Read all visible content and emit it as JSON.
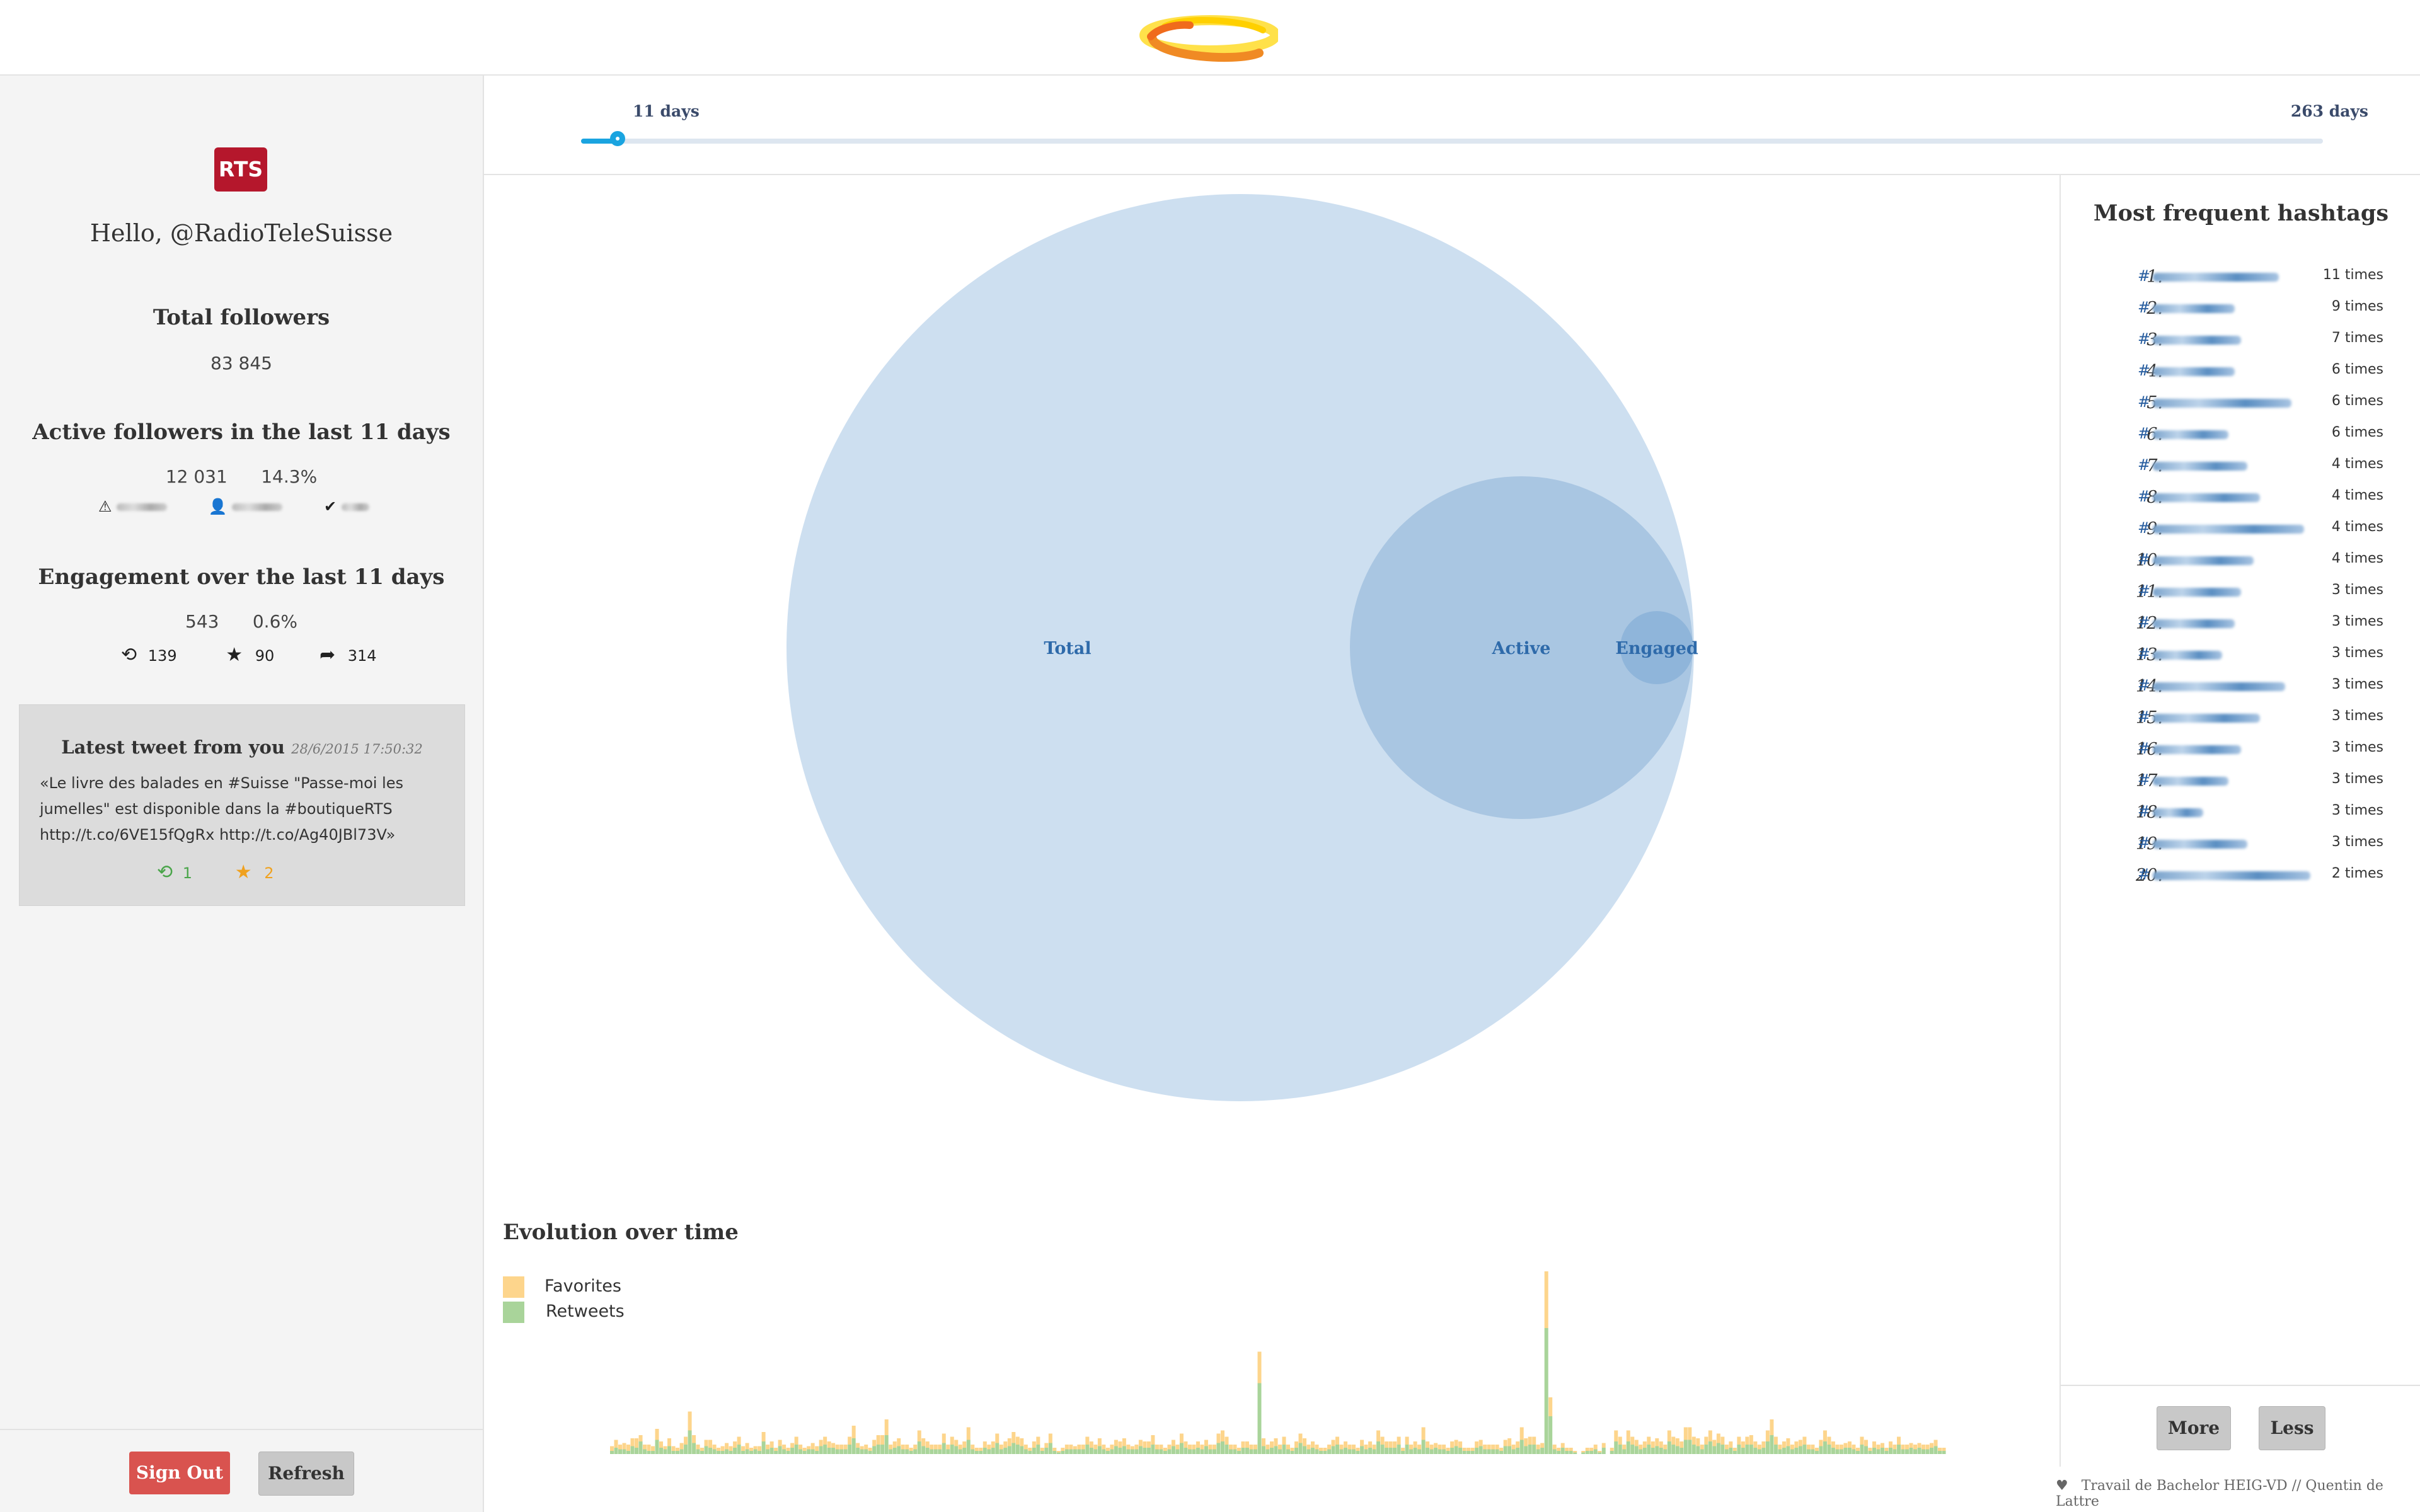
{
  "brand": {
    "logo_icon": "ring-logo-icon",
    "colors": {
      "orange": "#f08a24",
      "yellow": "#ffe14a",
      "red": "#b5172c"
    }
  },
  "user": {
    "badge": "RTS",
    "greeting": "Hello, @RadioTeleSuisse"
  },
  "followers": {
    "title": "Total followers",
    "total": "83 845"
  },
  "active": {
    "title": "Active followers in the last 11 days",
    "count": "12 031",
    "percent": "14.3%"
  },
  "engagement": {
    "title": "Engagement over the last 11 days",
    "count": "543",
    "percent": "0.6%",
    "retweets": "139",
    "favorites": "90",
    "replies": "314"
  },
  "tweet": {
    "title": "Latest tweet from you",
    "date": "28/6/2015 17:50:32",
    "text": "«Le livre des balades en #Suisse \"Passe-moi les jumelles\" est disponible dans la #boutiqueRTS http://t.co/6VE15fQgRx http://t.co/Ag40JBl73V»",
    "retweets": "1",
    "favorites": "2"
  },
  "buttons": {
    "sign_out": "Sign Out",
    "refresh": "Refresh",
    "more": "More",
    "less": "Less"
  },
  "slider": {
    "current_label": "11 days",
    "max_label": "263 days",
    "value_days": 11,
    "max_days": 263
  },
  "venn": {
    "total_label": "Total",
    "active_label": "Active",
    "engaged_label": "Engaged"
  },
  "hashtags": {
    "title": "Most frequent hashtags",
    "items": [
      {
        "rank": "1.",
        "hash": "#",
        "times": "11 times"
      },
      {
        "rank": "2.",
        "hash": "#",
        "times": "9 times"
      },
      {
        "rank": "3.",
        "hash": "#",
        "times": "7 times"
      },
      {
        "rank": "4.",
        "hash": "#",
        "times": "6 times"
      },
      {
        "rank": "5.",
        "hash": "#",
        "times": "6 times"
      },
      {
        "rank": "6.",
        "hash": "#",
        "times": "6 times"
      },
      {
        "rank": "7.",
        "hash": "#",
        "times": "4 times"
      },
      {
        "rank": "8.",
        "hash": "#",
        "times": "4 times"
      },
      {
        "rank": "9.",
        "hash": "#",
        "times": "4 times"
      },
      {
        "rank": "10.",
        "hash": "#",
        "times": "4 times"
      },
      {
        "rank": "11.",
        "hash": "#",
        "times": "3 times"
      },
      {
        "rank": "12.",
        "hash": "#",
        "times": "3 times"
      },
      {
        "rank": "13.",
        "hash": "#",
        "times": "3 times"
      },
      {
        "rank": "14.",
        "hash": "#",
        "times": "3 times"
      },
      {
        "rank": "15.",
        "hash": "#",
        "times": "3 times"
      },
      {
        "rank": "16.",
        "hash": "#",
        "times": "3 times"
      },
      {
        "rank": "17.",
        "hash": "#",
        "times": "3 times"
      },
      {
        "rank": "18.",
        "hash": "#",
        "times": "3 times"
      },
      {
        "rank": "19.",
        "hash": "#",
        "times": "3 times"
      },
      {
        "rank": "20.",
        "hash": "#",
        "times": "2 times"
      }
    ]
  },
  "evolution": {
    "title": "Evolution over time",
    "legend_favorites": "Favorites",
    "legend_retweets": "Retweets"
  },
  "chart_data": {
    "type": "bar",
    "title": "Evolution over time",
    "stacked": true,
    "series": [
      {
        "name": "Retweets",
        "color": "#a9d49a",
        "values": [
          2,
          4,
          3,
          3,
          2,
          5,
          4,
          8,
          3,
          2,
          2,
          9,
          4,
          3,
          5,
          2,
          2,
          3,
          6,
          15,
          7,
          3,
          2,
          5,
          4,
          3,
          2,
          2,
          3,
          2,
          4,
          6,
          2,
          3,
          2,
          3,
          2,
          8,
          3,
          4,
          2,
          5,
          3,
          2,
          4,
          6,
          3,
          2,
          3,
          3,
          2,
          5,
          6,
          4,
          4,
          3,
          3,
          3,
          6,
          10,
          4,
          3,
          3,
          2,
          5,
          6,
          6,
          12,
          3,
          4,
          5,
          3,
          3,
          2,
          3,
          8,
          5,
          4,
          3,
          3,
          3,
          7,
          3,
          6,
          5,
          3,
          4,
          9,
          3,
          2,
          2,
          4,
          3,
          4,
          7,
          3,
          4,
          5,
          7,
          6,
          5,
          3,
          2,
          4,
          6,
          2,
          4,
          7,
          2,
          1,
          2,
          3,
          3,
          3,
          3,
          3,
          6,
          4,
          3,
          5,
          3,
          2,
          3,
          5,
          4,
          5,
          3,
          3,
          3,
          5,
          4,
          4,
          6,
          3,
          3,
          2,
          3,
          5,
          3,
          7,
          4,
          3,
          3,
          4,
          3,
          5,
          3,
          3,
          7,
          8,
          6,
          3,
          3,
          2,
          4,
          4,
          3,
          3,
          45,
          5,
          3,
          4,
          5,
          3,
          6,
          3,
          2,
          4,
          7,
          5,
          3,
          4,
          3,
          2,
          2,
          3,
          5,
          6,
          3,
          4,
          3,
          3,
          2,
          5,
          3,
          4,
          3,
          8,
          6,
          4,
          4,
          4,
          6,
          2,
          6,
          3,
          4,
          3,
          9,
          4,
          3,
          4,
          3,
          3,
          2,
          4,
          5,
          4,
          2,
          2,
          2,
          4,
          5,
          3,
          3,
          3,
          3,
          2,
          5,
          5,
          3,
          4,
          9,
          5,
          6,
          6,
          3,
          4,
          80,
          24,
          3,
          2,
          4,
          2,
          2,
          1,
          0,
          1,
          2,
          2,
          3,
          1,
          4,
          0,
          2,
          8,
          6,
          3,
          8,
          6,
          5,
          3,
          4,
          6,
          4,
          5,
          4,
          3,
          8,
          6,
          5,
          4,
          9,
          9,
          6,
          5,
          3,
          6,
          8,
          5,
          7,
          6,
          3,
          4,
          2,
          6,
          4,
          6,
          6,
          4,
          3,
          4,
          8,
          12,
          6,
          3,
          4,
          5,
          3,
          4,
          5,
          6,
          3,
          3,
          2,
          5,
          8,
          6,
          4,
          3,
          3,
          4,
          4,
          3,
          2,
          6,
          5,
          2,
          4,
          3,
          4,
          2,
          4,
          3,
          6,
          3,
          3,
          4,
          3,
          4,
          3,
          3,
          4,
          5,
          2,
          2
        ]
      },
      {
        "name": "Favorites",
        "color": "#fdd58c",
        "values": [
          3,
          5,
          3,
          4,
          4,
          5,
          6,
          4,
          3,
          4,
          3,
          7,
          4,
          2,
          5,
          3,
          2,
          4,
          5,
          12,
          5,
          3,
          2,
          4,
          5,
          3,
          2,
          3,
          4,
          3,
          4,
          5,
          3,
          4,
          2,
          2,
          3,
          6,
          3,
          4,
          2,
          4,
          3,
          2,
          3,
          5,
          3,
          2,
          2,
          4,
          3,
          4,
          5,
          4,
          3,
          3,
          3,
          3,
          5,
          8,
          3,
          2,
          3,
          2,
          4,
          6,
          6,
          10,
          3,
          4,
          5,
          3,
          3,
          2,
          3,
          7,
          5,
          4,
          3,
          3,
          3,
          6,
          3,
          5,
          4,
          3,
          4,
          8,
          3,
          2,
          2,
          4,
          3,
          4,
          6,
          3,
          4,
          5,
          7,
          5,
          5,
          3,
          2,
          4,
          5,
          2,
          3,
          6,
          2,
          1,
          2,
          3,
          3,
          2,
          3,
          3,
          5,
          4,
          3,
          5,
          3,
          2,
          3,
          4,
          4,
          5,
          3,
          2,
          3,
          4,
          4,
          4,
          6,
          3,
          3,
          2,
          3,
          4,
          3,
          6,
          4,
          3,
          3,
          4,
          3,
          4,
          3,
          3,
          6,
          7,
          5,
          3,
          3,
          2,
          4,
          4,
          3,
          3,
          20,
          5,
          3,
          4,
          5,
          3,
          5,
          3,
          2,
          4,
          6,
          5,
          3,
          4,
          3,
          2,
          2,
          3,
          4,
          5,
          3,
          4,
          3,
          3,
          2,
          4,
          3,
          4,
          3,
          7,
          5,
          4,
          4,
          4,
          5,
          2,
          5,
          3,
          4,
          3,
          8,
          4,
          3,
          3,
          3,
          3,
          2,
          4,
          4,
          4,
          2,
          2,
          2,
          4,
          4,
          3,
          3,
          3,
          3,
          2,
          4,
          5,
          3,
          4,
          8,
          5,
          5,
          5,
          3,
          3,
          36,
          12,
          3,
          2,
          3,
          2,
          2,
          1,
          0,
          1,
          2,
          2,
          3,
          1,
          3,
          0,
          2,
          7,
          5,
          3,
          7,
          5,
          4,
          3,
          4,
          5,
          4,
          5,
          4,
          3,
          7,
          5,
          5,
          4,
          8,
          8,
          5,
          5,
          3,
          5,
          7,
          4,
          6,
          5,
          3,
          4,
          2,
          5,
          4,
          5,
          6,
          4,
          3,
          4,
          7,
          10,
          5,
          3,
          4,
          5,
          3,
          4,
          4,
          5,
          3,
          3,
          2,
          4,
          7,
          5,
          4,
          3,
          3,
          3,
          4,
          3,
          2,
          5,
          4,
          2,
          4,
          3,
          3,
          2,
          4,
          3,
          5,
          3,
          3,
          3,
          3,
          3,
          3,
          3,
          3,
          4,
          2,
          2
        ]
      }
    ]
  }
}
